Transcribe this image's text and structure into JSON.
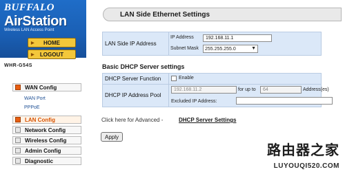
{
  "brand": {
    "name": "BUFFALO",
    "product": "AirStation",
    "tagline": "Wireless LAN Access Point",
    "model": "WHR-G54S"
  },
  "nav": {
    "home_label": "HOME",
    "logout_label": "LOGOUT"
  },
  "menu": {
    "wan": "WAN Config",
    "wan_port": "WAN Port",
    "pppoe": "PPPoE",
    "lan": "LAN Config",
    "network": "Network Config",
    "wireless": "Wireless Config",
    "admin": "Admin Config",
    "diagnostic": "Diagnostic"
  },
  "page": {
    "title": "LAN Side Ethernet Settings"
  },
  "lan_ip": {
    "label": "LAN Side IP Address",
    "ip_label": "IP Address",
    "ip_value": "192.168.11.1",
    "subnet_label": "Subnet Mask",
    "subnet_value": "255.255.255.0"
  },
  "dhcp": {
    "heading": "Basic DHCP Server settings",
    "function_label": "DHCP Server Function",
    "enable_label": "Enable",
    "enabled": false,
    "pool_label": "DHCP IP Address Pool",
    "pool_start": "192.168.11.2",
    "for_up_to": "for up to",
    "pool_count": "64",
    "addresses_label": "Address(es)",
    "excluded_label": "Excluded IP Address:",
    "excluded_value": ""
  },
  "advanced": {
    "text": "Click here for Advanced -",
    "link_label": "DHCP Server Settings"
  },
  "actions": {
    "apply_label": "Apply"
  },
  "watermark": {
    "line1": "路由器之家",
    "line2": "LUYOUQI520.COM"
  },
  "colors": {
    "brand_blue": "#1a5fb4",
    "nav_button": "#f3c73a",
    "active_marker": "#e85f12",
    "table_background": "#dbe8f8"
  }
}
